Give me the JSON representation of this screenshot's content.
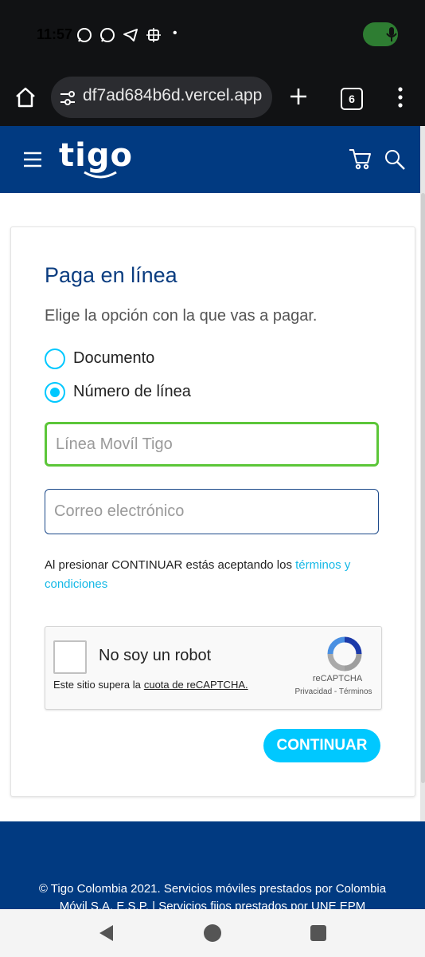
{
  "status_bar": {
    "time": "11:57",
    "dot": "•"
  },
  "browser": {
    "url": "df7ad684b6d.vercel.app",
    "tab_count": "6"
  },
  "header": {
    "logo": "tigo"
  },
  "form": {
    "title": "Paga en línea",
    "subtitle": "Elige la opción con la que vas a pagar.",
    "options": [
      {
        "label": "Documento",
        "selected": false
      },
      {
        "label": "Número de línea",
        "selected": true
      }
    ],
    "line_placeholder": "Línea Movíl Tigo",
    "email_placeholder": "Correo electrónico",
    "terms_text": "Al presionar CONTINUAR estás aceptando los ",
    "terms_link": "términos y condiciones",
    "continue_label": "CONTINUAR"
  },
  "captcha": {
    "label": "No soy un robot",
    "note": "Este sitio supera la",
    "note_link": "cuota de reCAPTCHA.",
    "brand": "reCAPTCHA",
    "links": "Privacidad - Términos"
  },
  "footer": {
    "text": "© Tigo Colombia 2021. Servicios móviles prestados por Colombia Móvil S.A. E.S.P. | Servicios fijos prestados por UNE EPM"
  },
  "colors": {
    "brand_blue": "#013a81",
    "accent_cyan": "#00c8ff",
    "focus_green": "#5cc639"
  },
  "icons": [
    "whatsapp-icon",
    "whatsapp-icon",
    "telegram-icon",
    "vpn-icon",
    "mic-icon",
    "home-icon",
    "site-settings-icon",
    "new-tab-icon",
    "tabs-icon",
    "more-icon",
    "menu-icon",
    "cart-icon",
    "search-icon",
    "recaptcha-icon",
    "back-icon",
    "home-nav-icon",
    "recents-icon"
  ]
}
